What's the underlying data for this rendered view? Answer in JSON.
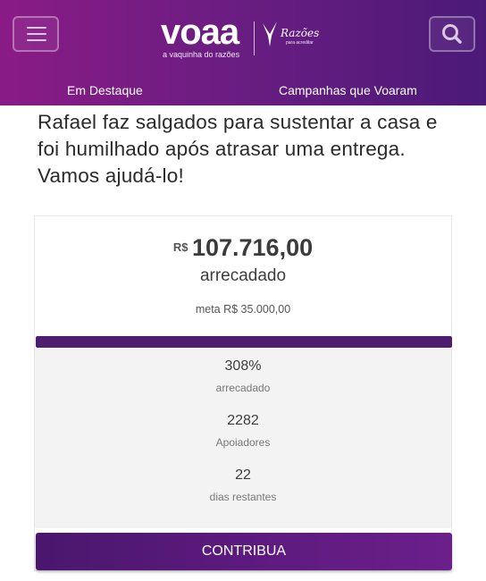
{
  "header": {
    "logo": "voaa",
    "logo_tagline": "a vaquinha do razões",
    "partner_logo": "Razões",
    "partner_tagline": "para acreditar",
    "nav": {
      "featured": "Em Destaque",
      "completed": "Campanhas que Voaram"
    },
    "icons": {
      "menu": "hamburger-menu-icon",
      "search": "search-icon",
      "partner": "bird-icon"
    }
  },
  "campaign": {
    "title": "Rafael faz salgados para sustentar a casa e foi humilhado após atrasar uma entrega. Vamos ajudá-lo!",
    "currency": "R$",
    "amount_raised": "107.716,00",
    "raised_label": "arrecadado",
    "goal_text": "meta R$ 35.000,00",
    "progress_fraction": 1.0,
    "stats": [
      {
        "value": "308%",
        "label": "arrecadado"
      },
      {
        "value": "2282",
        "label": "Apoiadores"
      },
      {
        "value": "22",
        "label": "dias restantes"
      }
    ],
    "cta_label": "CONTRIBUA"
  },
  "colors": {
    "header_start": "#8a1b86",
    "header_end": "#4b1a78",
    "progress": "#4f1d70",
    "cta": "#5c1a7e"
  }
}
